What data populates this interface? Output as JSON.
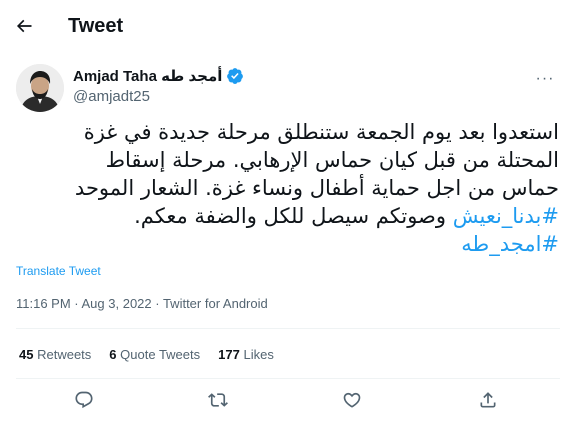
{
  "header": {
    "title": "Tweet",
    "back_icon": "arrow-left-icon"
  },
  "author": {
    "display_name": "Amjad Taha أمجد طه",
    "handle": "@amjadt25",
    "verified_icon": "verified-badge-icon",
    "avatar_icon": "avatar-photo",
    "more_label": "···"
  },
  "tweet": {
    "lines": [
      "استعدوا بعد يوم الجمعة ستنطلق مرحلة جديدة في غزة",
      "المحتلة من قبل كيان حماس الإرهابي. مرحلة إسقاط",
      "حماس من اجل حماية أطفال ونساء غزة. الشعار الموحد"
    ],
    "hashtag1": "#بدنا_نعيش",
    "line4_text": " وصوتكم سيصل للكل والضفة معكم.",
    "hashtag2": "#امجد_طه"
  },
  "translate_label": "Translate Tweet",
  "meta": {
    "time_date": "11:16 PM · Aug 3, 2022 · ",
    "source": "Twitter for Android"
  },
  "stats": {
    "retweets_count": "45",
    "retweets_label": "Retweets",
    "quotes_count": "6",
    "quotes_label": "Quote Tweets",
    "likes_count": "177",
    "likes_label": "Likes"
  },
  "actions": [
    "reply-icon",
    "retweet-icon",
    "like-icon",
    "share-icon"
  ],
  "colors": {
    "accent": "#1d9bf0",
    "text": "#0f1419",
    "secondary": "#536471",
    "divider": "#eff3f4"
  }
}
